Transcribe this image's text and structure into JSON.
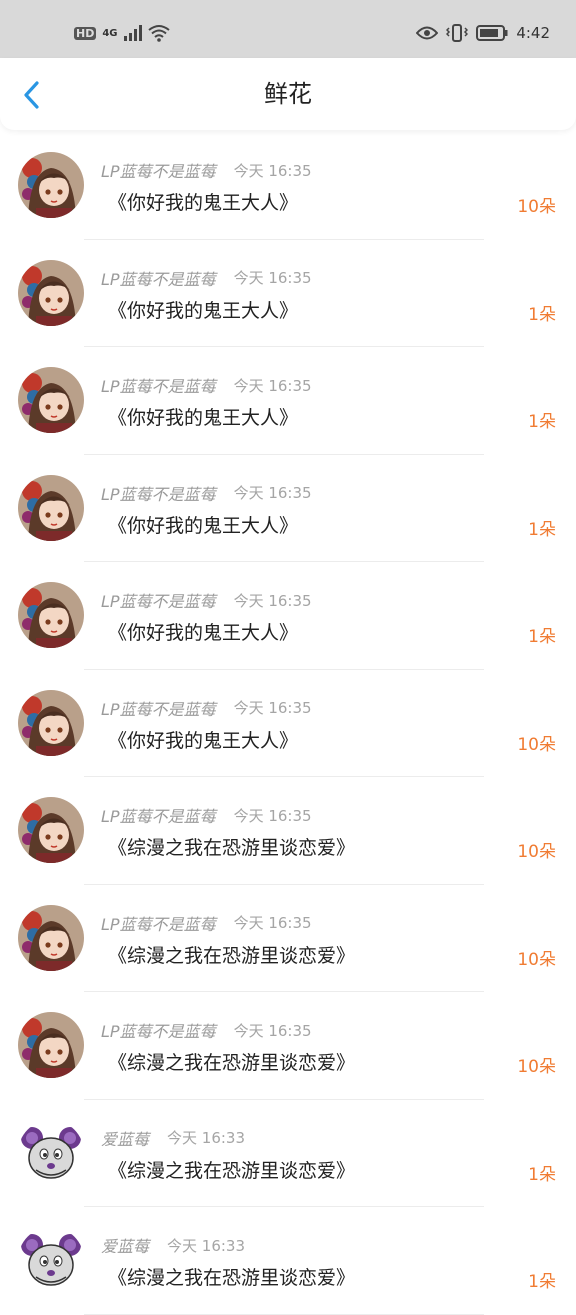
{
  "status_bar": {
    "left_icons": [
      "hd-icon",
      "4g-icon",
      "signal-icon",
      "wifi-icon"
    ],
    "hd_label": "HD",
    "network_label": "4G",
    "right_icons": [
      "eye-icon",
      "vibrate-icon",
      "battery-icon"
    ],
    "time": "4:42"
  },
  "header": {
    "title": "鲜花",
    "back_icon": "chevron-left-icon",
    "accent_color": "#2a96e3"
  },
  "colors": {
    "count": "#f07c33",
    "name": "#9a9a9a"
  },
  "items": [
    {
      "name": "LP蓝莓不是蓝莓",
      "time": "今天 16:35",
      "book": "《你好我的鬼王大人》",
      "count": "10朵",
      "avatar": "anime-girl-avatar"
    },
    {
      "name": "LP蓝莓不是蓝莓",
      "time": "今天 16:35",
      "book": "《你好我的鬼王大人》",
      "count": "1朵",
      "avatar": "anime-girl-avatar"
    },
    {
      "name": "LP蓝莓不是蓝莓",
      "time": "今天 16:35",
      "book": "《你好我的鬼王大人》",
      "count": "1朵",
      "avatar": "anime-girl-avatar"
    },
    {
      "name": "LP蓝莓不是蓝莓",
      "time": "今天 16:35",
      "book": "《你好我的鬼王大人》",
      "count": "1朵",
      "avatar": "anime-girl-avatar"
    },
    {
      "name": "LP蓝莓不是蓝莓",
      "time": "今天 16:35",
      "book": "《你好我的鬼王大人》",
      "count": "1朵",
      "avatar": "anime-girl-avatar"
    },
    {
      "name": "LP蓝莓不是蓝莓",
      "time": "今天 16:35",
      "book": "《你好我的鬼王大人》",
      "count": "10朵",
      "avatar": "anime-girl-avatar"
    },
    {
      "name": "LP蓝莓不是蓝莓",
      "time": "今天 16:35",
      "book": "《综漫之我在恐游里谈恋爱》",
      "count": "10朵",
      "avatar": "anime-girl-avatar"
    },
    {
      "name": "LP蓝莓不是蓝莓",
      "time": "今天 16:35",
      "book": "《综漫之我在恐游里谈恋爱》",
      "count": "10朵",
      "avatar": "anime-girl-avatar"
    },
    {
      "name": "LP蓝莓不是蓝莓",
      "time": "今天 16:35",
      "book": "《综漫之我在恐游里谈恋爱》",
      "count": "10朵",
      "avatar": "anime-girl-avatar"
    },
    {
      "name": "爱蓝莓",
      "time": "今天 16:33",
      "book": "《综漫之我在恐游里谈恋爱》",
      "count": "1朵",
      "avatar": "mouse-avatar"
    },
    {
      "name": "爱蓝莓",
      "time": "今天 16:33",
      "book": "《综漫之我在恐游里谈恋爱》",
      "count": "1朵",
      "avatar": "mouse-avatar"
    }
  ]
}
